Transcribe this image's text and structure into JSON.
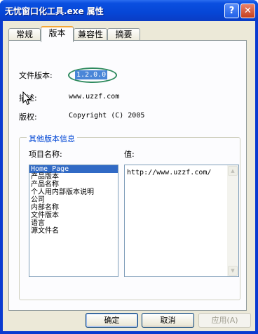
{
  "window": {
    "title": "无忧窗口化工具.exe 属性",
    "help_label": "?",
    "close_label": "✕"
  },
  "tabs": [
    {
      "label": "常规",
      "active": false
    },
    {
      "label": "版本",
      "active": true
    },
    {
      "label": "兼容性",
      "active": false
    },
    {
      "label": "摘要",
      "active": false
    }
  ],
  "version_tab": {
    "file_version_label": "文件版本:",
    "file_version_value": "1.2.0.0",
    "description_label": "描述:",
    "description_value": "www.uzzf.com",
    "copyright_label": "版权:",
    "copyright_value": "Copyright (C) 2005",
    "other_info_title": "其他版本信息",
    "item_name_label": "项目名称:",
    "value_label": "值:",
    "items": [
      "Home Page",
      "产品版本",
      "产品名称",
      "个人用内部版本说明",
      "公司",
      "内部名称",
      "文件版本",
      "语言",
      "源文件名"
    ],
    "selected_index": 0,
    "selected_value": "http://www.uzzf.com/"
  },
  "buttons": {
    "ok": "确定",
    "cancel": "取消",
    "apply": "应用(A)"
  },
  "icons": {
    "cursor": "arrow-cursor-icon",
    "scroll_up": "scroll-up-arrow-icon",
    "scroll_down": "scroll-down-arrow-icon"
  }
}
